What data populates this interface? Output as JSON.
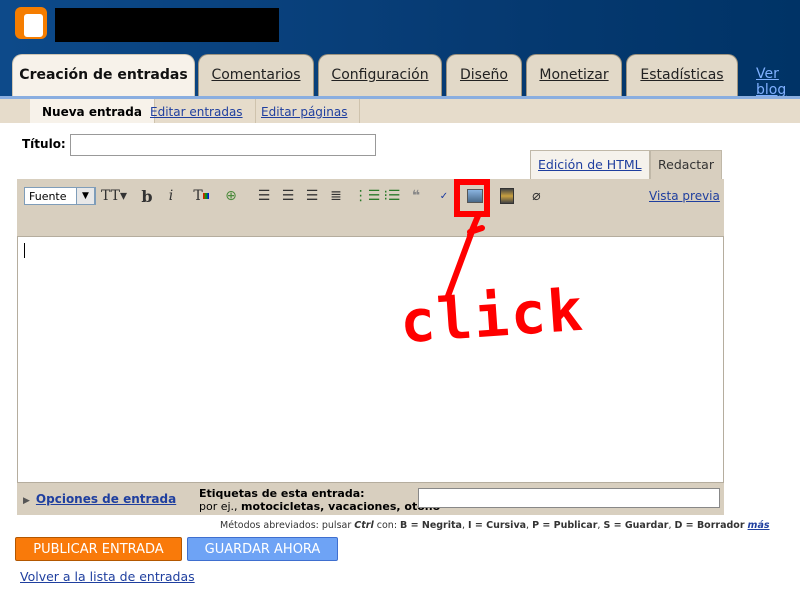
{
  "header": {
    "nav_tabs": [
      {
        "label": "Creación de entradas",
        "active": true
      },
      {
        "label": "Comentarios"
      },
      {
        "label": "Configuración"
      },
      {
        "label": "Diseño"
      },
      {
        "label": "Monetizar"
      },
      {
        "label": "Estadísticas"
      }
    ],
    "view_blog": "Ver blog"
  },
  "subnav": [
    {
      "label": "Nueva entrada",
      "active": true
    },
    {
      "label": "Editar entradas"
    },
    {
      "label": "Editar páginas"
    }
  ],
  "post": {
    "title_label": "Título:",
    "title_value": ""
  },
  "editor_modes": {
    "html": "Edición de HTML",
    "compose": "Redactar"
  },
  "toolbar": {
    "font_select": "Fuente",
    "preview": "Vista previa",
    "icons": [
      "font-size-icon",
      "bold-icon",
      "italic-icon",
      "text-color-icon",
      "link-icon",
      "align-left-icon",
      "align-center-icon",
      "align-right-icon",
      "justify-icon",
      "numbered-list-icon",
      "bullet-list-icon",
      "blockquote-icon",
      "spellcheck-icon",
      "insert-image-icon",
      "insert-video-icon",
      "remove-formatting-icon"
    ]
  },
  "bottom": {
    "options": "Opciones de entrada",
    "tags_label": "Etiquetas de esta entrada:",
    "tags_hint_prefix": "por ej., ",
    "tags_hint_examples": "motocicletas, vacaciones, otoño",
    "tags_value": ""
  },
  "shortcuts": {
    "prefix": "Métodos abreviados: pulsar ",
    "ctrl": "Ctrl",
    "con": " con: ",
    "items": [
      "B = Negrita",
      "I = Cursiva",
      "P = Publicar",
      "S = Guardar",
      "D = Borrador"
    ],
    "more": "más"
  },
  "buttons": {
    "publish": "PUBLICAR ENTRADA",
    "save": "GUARDAR AHORA"
  },
  "back_link": "Volver a la lista de entradas",
  "annotation": {
    "text": "click",
    "color": "#ff0000"
  }
}
